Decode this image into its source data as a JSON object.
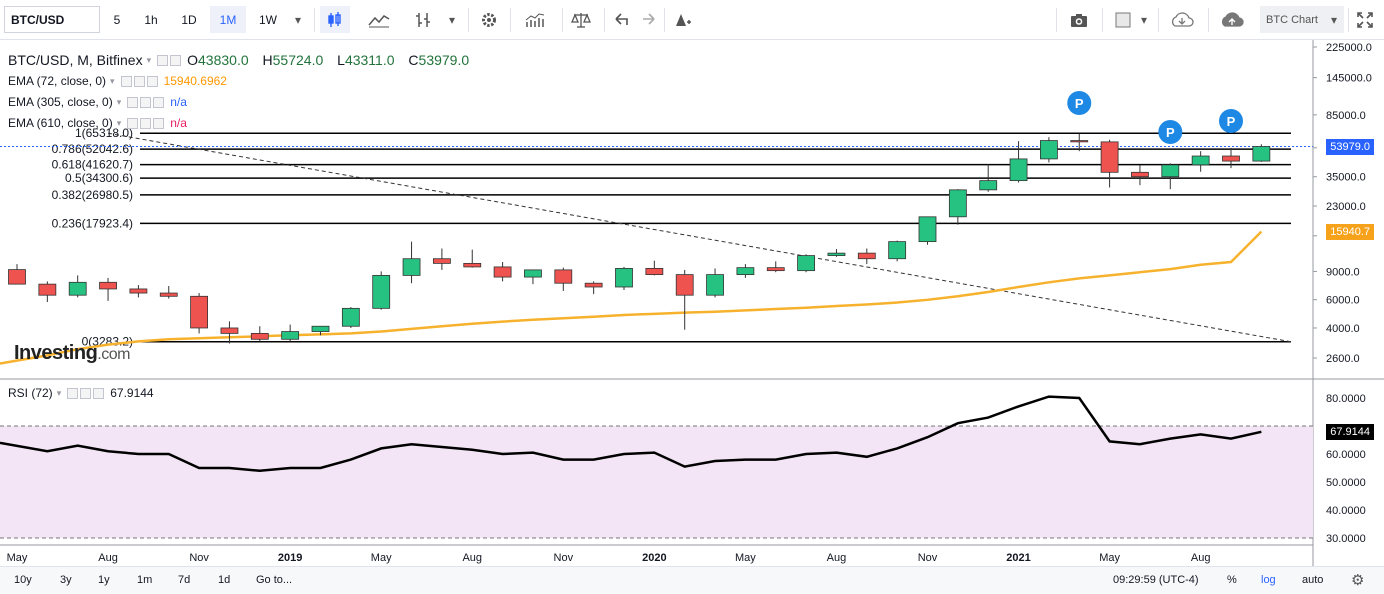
{
  "toolbar": {
    "symbol": "BTC/USD",
    "intervals": [
      "5",
      "1h",
      "1D",
      "1M",
      "1W"
    ],
    "active_interval": "1M",
    "chart_name": "BTC Chart"
  },
  "legend": {
    "title": "BTC/USD, M, Bitfinex",
    "ohlc": {
      "o_label": "O",
      "o": "43830.0",
      "h_label": "H",
      "h": "55724.0",
      "l_label": "L",
      "l": "43311.0",
      "c_label": "C",
      "c": "53979.0"
    },
    "ema72": {
      "label": "EMA (72, close, 0)",
      "value": "15940.6962",
      "color": "#ff9800"
    },
    "ema305": {
      "label": "EMA (305, close, 0)",
      "value": "n/a",
      "color": "#2962ff"
    },
    "ema610": {
      "label": "EMA (610, close, 0)",
      "value": "n/a",
      "color": "#e91e63"
    }
  },
  "fib_levels": [
    {
      "label": "1(65318.0)",
      "value": 65318.0
    },
    {
      "label": "0.786(52042.6)",
      "value": 52042.6
    },
    {
      "label": "0.618(41620.7)",
      "value": 41620.7
    },
    {
      "label": "0.5(34300.6)",
      "value": 34300.6
    },
    {
      "label": "0.382(26980.5)",
      "value": 26980.5
    },
    {
      "label": "0.236(17923.4)",
      "value": 17923.4
    },
    {
      "label": "0(3283.2)",
      "value": 3283.2
    }
  ],
  "watermark": {
    "brand": "Investing",
    "suffix": ".com"
  },
  "price_axis": [
    "225000.0",
    "145000.0",
    "85000.0",
    "53000.0",
    "35000.0",
    "23000.0",
    "15000.0",
    "9000.0",
    "6000.0",
    "4000.0",
    "2600.0"
  ],
  "last_price": "53979.0",
  "ema_price": "15940.7",
  "rsi": {
    "label": "RSI (72)",
    "value": "67.9144",
    "axis": [
      "80.0000",
      "60.0000",
      "50.0000",
      "40.0000",
      "30.0000"
    ],
    "upper": 70,
    "lower": 30
  },
  "time_axis": [
    "May",
    "Aug",
    "Nov",
    "2019",
    "May",
    "Aug",
    "Nov",
    "2020",
    "May",
    "Aug",
    "Nov",
    "2021",
    "May",
    "Aug"
  ],
  "bottom_bar": {
    "ranges": [
      "10y",
      "3y",
      "1y",
      "1m",
      "7d",
      "1d",
      "Go to..."
    ],
    "time": "09:29:59 (UTC-4)",
    "pct": "%",
    "log": "log",
    "auto": "auto"
  },
  "marker_label": "P",
  "chart_data": {
    "type": "candlestick",
    "interval": "monthly",
    "scale": "log",
    "colors": {
      "up": "#26c281",
      "down": "#ef5350",
      "ema": "#f7b22d",
      "rsi": "#000000",
      "rsi_band": "#f3e5f5"
    },
    "candles": [
      {
        "o": 9240,
        "h": 10000,
        "l": 7900,
        "c": 7500
      },
      {
        "o": 7500,
        "h": 7800,
        "l": 5800,
        "c": 6400
      },
      {
        "o": 6400,
        "h": 8500,
        "l": 6200,
        "c": 7700
      },
      {
        "o": 7700,
        "h": 8200,
        "l": 5900,
        "c": 7000
      },
      {
        "o": 7000,
        "h": 7400,
        "l": 6200,
        "c": 6600
      },
      {
        "o": 6600,
        "h": 7300,
        "l": 6100,
        "c": 6300
      },
      {
        "o": 6300,
        "h": 6600,
        "l": 3700,
        "c": 4000
      },
      {
        "o": 4000,
        "h": 4400,
        "l": 3200,
        "c": 3700
      },
      {
        "o": 3700,
        "h": 4100,
        "l": 3300,
        "c": 3400
      },
      {
        "o": 3400,
        "h": 4200,
        "l": 3300,
        "c": 3800
      },
      {
        "o": 3800,
        "h": 4100,
        "l": 3600,
        "c": 4100
      },
      {
        "o": 4100,
        "h": 5400,
        "l": 4000,
        "c": 5300
      },
      {
        "o": 5300,
        "h": 9000,
        "l": 5200,
        "c": 8500
      },
      {
        "o": 8500,
        "h": 13800,
        "l": 7600,
        "c": 10800
      },
      {
        "o": 10800,
        "h": 12500,
        "l": 9200,
        "c": 10100
      },
      {
        "o": 10100,
        "h": 12300,
        "l": 9500,
        "c": 9600
      },
      {
        "o": 9600,
        "h": 10300,
        "l": 7800,
        "c": 8300
      },
      {
        "o": 8300,
        "h": 9200,
        "l": 7500,
        "c": 9200
      },
      {
        "o": 9200,
        "h": 9500,
        "l": 6800,
        "c": 7600
      },
      {
        "o": 7600,
        "h": 7800,
        "l": 6500,
        "c": 7200
      },
      {
        "o": 7200,
        "h": 9600,
        "l": 6900,
        "c": 9400
      },
      {
        "o": 9400,
        "h": 10500,
        "l": 8500,
        "c": 8600
      },
      {
        "o": 8600,
        "h": 9200,
        "l": 3900,
        "c": 6400
      },
      {
        "o": 6400,
        "h": 9400,
        "l": 6200,
        "c": 8600
      },
      {
        "o": 8600,
        "h": 10000,
        "l": 8200,
        "c": 9500
      },
      {
        "o": 9500,
        "h": 10400,
        "l": 8900,
        "c": 9100
      },
      {
        "o": 9100,
        "h": 11500,
        "l": 8900,
        "c": 11300
      },
      {
        "o": 11300,
        "h": 12400,
        "l": 11100,
        "c": 11700
      },
      {
        "o": 11700,
        "h": 12500,
        "l": 10000,
        "c": 10800
      },
      {
        "o": 10800,
        "h": 14000,
        "l": 10400,
        "c": 13800
      },
      {
        "o": 13800,
        "h": 19800,
        "l": 13200,
        "c": 19700
      },
      {
        "o": 19700,
        "h": 29300,
        "l": 17600,
        "c": 29000
      },
      {
        "o": 29000,
        "h": 41900,
        "l": 28200,
        "c": 33100
      },
      {
        "o": 33100,
        "h": 58300,
        "l": 32200,
        "c": 45200
      },
      {
        "o": 45200,
        "h": 61700,
        "l": 43000,
        "c": 58800
      },
      {
        "o": 58800,
        "h": 64800,
        "l": 50500,
        "c": 57700
      },
      {
        "o": 57700,
        "h": 59500,
        "l": 30000,
        "c": 37300
      },
      {
        "o": 37300,
        "h": 41300,
        "l": 31000,
        "c": 35000
      },
      {
        "o": 35000,
        "h": 42400,
        "l": 29300,
        "c": 41500
      },
      {
        "o": 41500,
        "h": 50500,
        "l": 37600,
        "c": 47100
      },
      {
        "o": 47100,
        "h": 52900,
        "l": 39600,
        "c": 43800
      },
      {
        "o": 43800,
        "h": 55724,
        "l": 43311,
        "c": 53979
      }
    ],
    "ema72": [
      2400,
      2700,
      2950,
      3150,
      3300,
      3400,
      3450,
      3500,
      3550,
      3600,
      3650,
      3700,
      3800,
      3950,
      4100,
      4250,
      4380,
      4500,
      4600,
      4700,
      4820,
      4900,
      4980,
      5050,
      5150,
      5250,
      5350,
      5480,
      5600,
      5760,
      5990,
      6300,
      6700,
      7200,
      7700,
      8150,
      8500,
      8900,
      9300,
      9900,
      10300,
      15940
    ],
    "rsi72": [
      64,
      61,
      63,
      61,
      60,
      60,
      55,
      55,
      54,
      55,
      55,
      58,
      62,
      63.5,
      62.5,
      61.5,
      60,
      60.5,
      58,
      58,
      60,
      60.5,
      55.5,
      57.5,
      58,
      58,
      60,
      60.5,
      59,
      62,
      66,
      71,
      73,
      77,
      80.5,
      80,
      64.5,
      63.5,
      65.5,
      67,
      65.5,
      67.9144
    ],
    "p_markers": [
      35,
      38,
      40
    ]
  }
}
